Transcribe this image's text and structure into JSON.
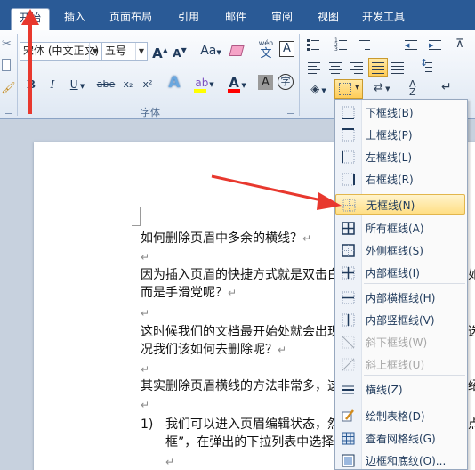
{
  "tabs": [
    "开始",
    "插入",
    "页面布局",
    "引用",
    "邮件",
    "审阅",
    "视图",
    "开发工具"
  ],
  "active_tab": 0,
  "font": {
    "group_label": "字体",
    "name_value": "宋体 (中文正文)",
    "size_value": "五号",
    "grow_label": "A",
    "shrink_label": "A",
    "case_label": "Aa",
    "wen_label": "wén",
    "char_border_label": "A",
    "bold": "B",
    "italic": "I",
    "underline": "U",
    "strike": "abe",
    "subscript": "x₂",
    "superscript": "x²",
    "char_shade_label": "A",
    "enclose_label": "字",
    "font_color": "#ff0000",
    "highlight_color": "#ffff00"
  },
  "menu": {
    "items": [
      {
        "label": "下框线(B)",
        "icon": "border-bottom-icon",
        "disabled": false
      },
      {
        "label": "上框线(P)",
        "icon": "border-top-icon",
        "disabled": false
      },
      {
        "label": "左框线(L)",
        "icon": "border-left-icon",
        "disabled": false
      },
      {
        "label": "右框线(R)",
        "icon": "border-right-icon",
        "disabled": false
      },
      {
        "label": "无框线(N)",
        "icon": "border-none-icon",
        "disabled": false,
        "highlighted": true
      },
      {
        "label": "所有框线(A)",
        "icon": "border-all-icon",
        "disabled": false
      },
      {
        "label": "外侧框线(S)",
        "icon": "border-outside-icon",
        "disabled": false
      },
      {
        "label": "内部框线(I)",
        "icon": "border-inside-icon",
        "disabled": false
      },
      {
        "label": "内部横框线(H)",
        "icon": "border-inside-horizontal-icon",
        "disabled": false
      },
      {
        "label": "内部竖框线(V)",
        "icon": "border-inside-vertical-icon",
        "disabled": false
      },
      {
        "label": "斜下框线(W)",
        "icon": "diagonal-down-icon",
        "disabled": true
      },
      {
        "label": "斜上框线(U)",
        "icon": "diagonal-up-icon",
        "disabled": true
      },
      {
        "label": "横线(Z)",
        "icon": "horizontal-line-icon",
        "disabled": false
      },
      {
        "label": "绘制表格(D)",
        "icon": "draw-table-icon",
        "disabled": false
      },
      {
        "label": "查看网格线(G)",
        "icon": "view-gridlines-icon",
        "disabled": false
      },
      {
        "label": "边框和底纹(O)...",
        "icon": "borders-shading-icon",
        "disabled": false
      }
    ]
  },
  "document": {
    "lines": [
      "如何删除页眉中多余的横线？",
      "",
      "因为插入页眉的快捷方式就是双击白",
      "而是手滑党呢？",
      "",
      "这时候我们的文档最开始处就会出现",
      "况我们该如何去删除呢？",
      "",
      "其实删除页眉横线的方法非常多，这",
      "",
      "我们可以进入页眉编辑状态，然",
      "框”，在弹出的下拉列表中选择",
      ""
    ],
    "right_fragments": [
      "如",
      "选",
      "绍",
      "点"
    ],
    "list_number": "1)",
    "para_mark": "↵"
  },
  "colors": {
    "tabbar": "#2a5a96",
    "arrow": "#e8382e",
    "menu_highlight": "#ffdf85"
  }
}
